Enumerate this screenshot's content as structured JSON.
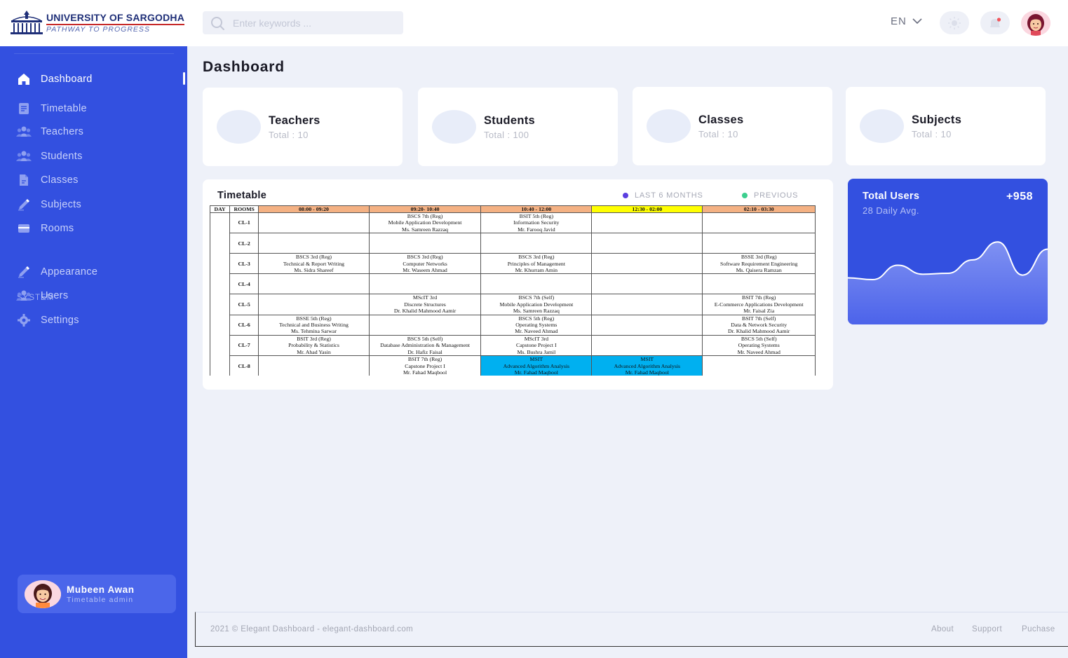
{
  "brand": {
    "name": "UNIVERSITY OF SARGODHA",
    "tagline": "PATHWAY TO PROGRESS"
  },
  "search": {
    "placeholder": "Enter keywords ..."
  },
  "language": {
    "current": "EN"
  },
  "sidebar": {
    "items": [
      {
        "label": "Dashboard",
        "icon": "home-icon",
        "active": true
      },
      {
        "label": "Timetable",
        "icon": "document-icon"
      },
      {
        "label": "Teachers",
        "icon": "users-icon"
      },
      {
        "label": "Students",
        "icon": "users-icon"
      },
      {
        "label": "Classes",
        "icon": "file-icon"
      },
      {
        "label": "Subjects",
        "icon": "pencil-icon"
      },
      {
        "label": "Rooms",
        "icon": "box-icon"
      }
    ],
    "section_label": "SYSTEM",
    "system_items": [
      {
        "label": "Appearance",
        "icon": "pencil-icon"
      },
      {
        "label": "Users",
        "icon": "users-icon"
      },
      {
        "label": "Settings",
        "icon": "gear-icon"
      }
    ],
    "user": {
      "name": "Mubeen Awan",
      "role": "Timetable admin"
    }
  },
  "page": {
    "title": "Dashboard"
  },
  "stats": [
    {
      "name": "Teachers",
      "total": "Total : 10"
    },
    {
      "name": "Students",
      "total": "Total : 100"
    },
    {
      "name": "Classes",
      "total": "Total : 10"
    },
    {
      "name": "Subjects",
      "total": "Total : 10"
    }
  ],
  "timetable": {
    "title": "Timetable",
    "legend": [
      {
        "label": "LAST 6 MONTHS",
        "color": "#5b3fe0"
      },
      {
        "label": "PREVIOUS",
        "color": "#3ccf8e"
      }
    ],
    "headers": [
      "DAY",
      "ROOMS",
      "08:00 - 09:20",
      "09:20- 10:40",
      "10:40 - 12:00",
      "12:30 - 02:00",
      "02:10 - 03:30"
    ],
    "rows": [
      {
        "room": "CL-1",
        "cells": [
          "",
          "BSCS 7th (Reg)\nMobile Application Development\nMs. Samreen Razzaq",
          "BSIT 5th (Reg)\nInformation Security\nMr. Farooq Javid",
          "",
          ""
        ]
      },
      {
        "room": "CL-2",
        "cells": [
          "",
          "",
          "",
          "",
          ""
        ]
      },
      {
        "room": "CL-3",
        "cells": [
          "BSCS 3rd (Reg)\nTechnical & Report Writing\nMs. Sidra Shareef",
          "BSCS 3rd (Reg)\nComputer Networks\nMr. Waseem Ahmad",
          "BSCS 3rd (Reg)\nPrinciples of Management\nMr. Khurram Amin",
          "",
          "BSSE 3rd (Reg)\nSoftware Requirement Engineering\nMs. Qaisera Ramzan"
        ]
      },
      {
        "room": "CL-4",
        "cells": [
          "",
          "",
          "",
          "",
          ""
        ]
      },
      {
        "room": "CL-5",
        "cells": [
          "",
          "MScIT 3rd\nDiscrete Structures\nDr. Khalid Mahmood Aamir",
          "BSCS 7th (Self)\nMobile Application Development\nMs. Samreen Razzaq",
          "",
          "BSIT 7th (Reg)\nE-Commerce Applications Development\nMr. Faisal Zia"
        ]
      },
      {
        "room": "CL-6",
        "cells": [
          "BSSE 5th (Reg)\nTechnical and Business Writing\nMs. Tehmina Sarwar",
          "",
          "BSCS 5th (Reg)\nOperating Systems\nMr. Naveed Ahmad",
          "",
          "BSIT 7th (Self)\nData & Network Security\nDr. Khalid Mahmood Aamir"
        ]
      },
      {
        "room": "CL-7",
        "cells": [
          "BSIT 3rd (Reg)\nProbability & Statistics\nMr. Ahad Yasin",
          "BSCS 5th (Self)\nDatabase Administration & Management\nDr. Hafiz Faisal",
          "MScIT 3rd\nCapstone Project I\nMs. Bushra Jamil",
          "",
          "BSCS 5th (Self)\nOperating Systems\nMr. Naveed Ahmad"
        ]
      },
      {
        "room": "CL-8",
        "cells": [
          "",
          "BSIT 7th (Reg)\nCapstone Project I\nMr. Fahad Maqbool",
          "MSIT\nAdvanced Algorithm Analysis\nMr. Fahad Maqbool",
          "MSIT\nAdvanced Algorithm Analysis\nMr. Fahad Maqbool",
          ""
        ]
      }
    ]
  },
  "users_card": {
    "title": "Total Users",
    "value": "+958",
    "subtitle": "28 Daily Avg.",
    "wave": [
      0.52,
      0.5,
      0.66,
      0.56,
      0.57,
      0.72,
      0.92,
      0.55,
      0.84
    ]
  },
  "footer": {
    "copyright": "2021 © Elegant Dashboard - elegant-dashboard.com",
    "links": [
      "About",
      "Support",
      "Puchase"
    ]
  }
}
